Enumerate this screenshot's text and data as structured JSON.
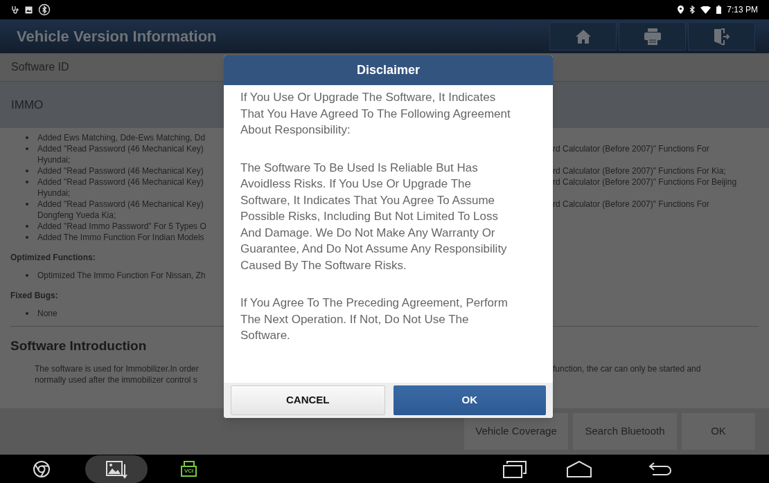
{
  "status_bar": {
    "time": "7:13 PM"
  },
  "header": {
    "title": "Vehicle Version Information"
  },
  "software_id": {
    "label": "Software ID"
  },
  "section": {
    "title": "IMMO"
  },
  "new_functions": [
    {
      "left": "Added Ews Matching, Dde-Ews Matching, Dd"
    },
    {
      "left": "Added \"Read Password (46 Mechanical Key)",
      "right": "rd Calculator (Before 2007)\" Functions For",
      "continuation": "Hyundai;"
    },
    {
      "left": "Added \"Read Password (46 Mechanical Key)",
      "right": "rd Calculator (Before 2007)\" Functions For Kia;"
    },
    {
      "left": "Added \"Read Password (46 Mechanical Key)",
      "right": "rd Calculator (Before 2007)\" Functions For Beijing",
      "continuation": "Hyundai;"
    },
    {
      "left": "Added \"Read Password (46 Mechanical Key)",
      "right": "rd Calculator (Before 2007)\" Functions For",
      "continuation": "Dongfeng Yueda Kia;"
    },
    {
      "left": "Added \"Read Immo Password\" For 5 Types O"
    },
    {
      "left": "Added The Immo Function For Indian Models"
    }
  ],
  "optimized": {
    "heading": "Optimized Functions:",
    "items": [
      "Optimized The Immo Function For Nissan, Zh"
    ]
  },
  "fixed": {
    "heading": "Fixed Bugs:",
    "items": [
      "None"
    ]
  },
  "introduction": {
    "heading": "Software Introduction",
    "lines": [
      {
        "left": "The software is used for Immobilizer.In order",
        "right": "function, the car can only be started and"
      },
      {
        "left": "normally used after the immobilizer control s"
      }
    ]
  },
  "bottom_buttons": [
    "Vehicle Coverage",
    "Search Bluetooth",
    "OK"
  ],
  "dialog": {
    "title": "Disclaimer",
    "paragraphs": [
      "If You Use Or Upgrade The Software, It Indicates That You Have Agreed To The Following Agreement About Responsibility:",
      "The Software To Be Used Is Reliable But Has Avoidless Risks. If You Use Or Upgrade The Software, It Indicates That You Agree To Assume Possible Risks, Including But Not Limited To Loss And Damage. We Do Not Make Any Warranty Or Guarantee, And Do Not Assume Any Responsibility Caused By The Software Risks.",
      "If You Agree To The Preceding Agreement, Perform The Next Operation. If Not, Do Not Use The Software."
    ],
    "buttons": [
      {
        "label": "CANCEL",
        "kind": "secondary"
      },
      {
        "label": "OK",
        "kind": "primary"
      }
    ]
  },
  "nav_bar": {
    "vci_label": "VCI"
  }
}
